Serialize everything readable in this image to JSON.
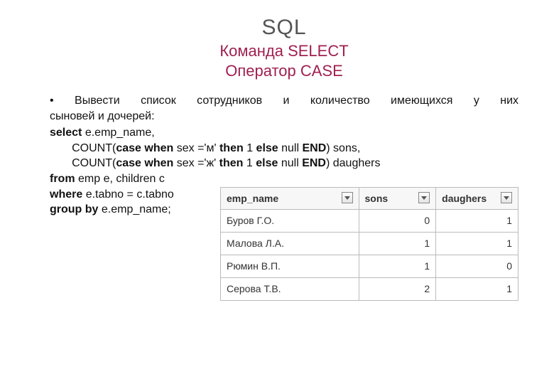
{
  "title": {
    "main": "SQL",
    "sub1": "Команда SELECT",
    "sub2": "Оператор CASE"
  },
  "bullet": {
    "line1": "Вывести список сотрудников и количество имеющихся у них",
    "line2": "сыновей и дочерей:"
  },
  "sql": {
    "kw_select": "select",
    "select_expr": " e.emp_name,",
    "count1_a": "       COUNT(",
    "kw_case1": "case when",
    "case1_mid": " sex ='м' ",
    "kw_then1": "then",
    "then1_mid": " 1 ",
    "kw_else1": "else",
    "else1_mid": " null ",
    "kw_end1": "END",
    "end1_tail": ") sons,",
    "count2_a": "       COUNT(",
    "kw_case2": "case when",
    "case2_mid": " sex ='ж' ",
    "kw_then2": "then",
    "then2_mid": " 1 ",
    "kw_else2": "else",
    "else2_mid": " null ",
    "kw_end2": "END",
    "end2_tail": ") daughers",
    "kw_from": "from",
    "from_expr": " emp e, children c",
    "kw_where": "where",
    "where_expr": " e.tabno = c.tabno",
    "kw_group": "group by",
    "group_expr": " e.emp_name;"
  },
  "table": {
    "headers": {
      "c1": "emp_name",
      "c2": "sons",
      "c3": "daughers"
    },
    "rows": [
      {
        "name": "Буров Г.О.",
        "sons": "0",
        "daughers": "1"
      },
      {
        "name": "Малова Л.А.",
        "sons": "1",
        "daughers": "1"
      },
      {
        "name": "Рюмин В.П.",
        "sons": "1",
        "daughers": "0"
      },
      {
        "name": "Серова Т.В.",
        "sons": "2",
        "daughers": "1"
      }
    ]
  }
}
